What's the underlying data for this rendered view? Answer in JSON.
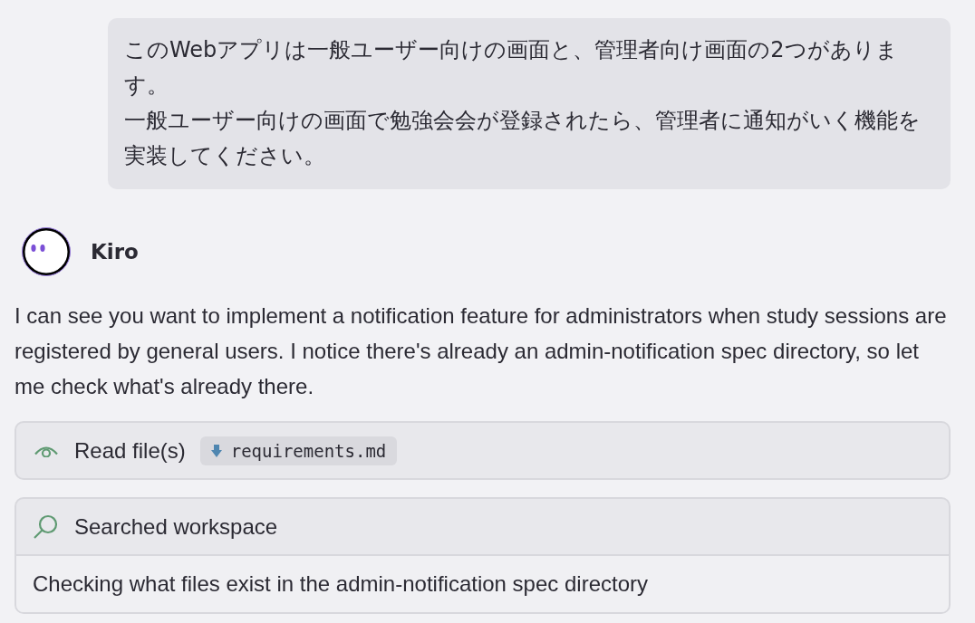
{
  "user_message": {
    "paragraphs": [
      "このWebアプリは一般ユーザー向けの画面と、管理者向け画面の2つがあります。",
      "一般ユーザー向けの画面で勉強会会が登録されたら、管理者に通知がいく機能を実装してください。"
    ]
  },
  "assistant": {
    "name": "Kiro",
    "message": "I can see you want to implement a notification feature for administrators when study sessions are registered by general users. I notice there's already an admin-notification spec directory, so let me check what's already there."
  },
  "tool_calls": [
    {
      "kind": "read",
      "label": "Read file(s)",
      "files": [
        "requirements.md"
      ]
    },
    {
      "kind": "search",
      "label": "Searched workspace",
      "detail": "Checking what files exist in the admin-notification spec directory"
    }
  ]
}
